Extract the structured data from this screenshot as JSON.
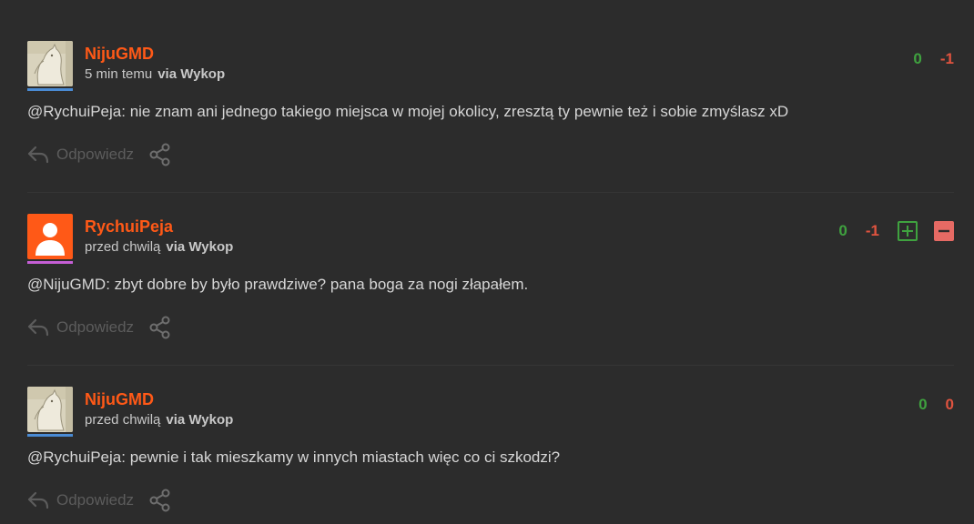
{
  "comments": [
    {
      "username": "NijuGMD",
      "time": "5 min temu",
      "via": "via Wykop",
      "avatar": "horse-avatar",
      "underline_color": "#4a8bd4",
      "votes_plus": "0",
      "votes_minus": "-1",
      "vote_buttons": false,
      "text": "@RychuiPeja: nie znam ani jednego takiego miejsca w mojej okolicy, zresztą ty pewnie też i sobie zmyślasz xD",
      "reply_label": "Odpowiedz"
    },
    {
      "username": "RychuiPeja",
      "time": "przed chwilą",
      "via": "via Wykop",
      "avatar": "default-user-avatar",
      "underline_color": "#c65fd6",
      "votes_plus": "0",
      "votes_minus": "-1",
      "vote_buttons": true,
      "text": "@NijuGMD: zbyt dobre by było prawdziwe? pana boga za nogi złapałem.",
      "reply_label": "Odpowiedz"
    },
    {
      "username": "NijuGMD",
      "time": "przed chwilą",
      "via": "via Wykop",
      "avatar": "horse-avatar",
      "underline_color": "#4a8bd4",
      "votes_plus": "0",
      "votes_minus": "0",
      "vote_buttons": false,
      "text": "@RychuiPeja: pewnie i tak mieszkamy w innych miastach więc co ci szkodzi?",
      "reply_label": "Odpowiedz"
    }
  ],
  "colors": {
    "background": "#2c2c2c",
    "username": "#ff5917",
    "vote_plus": "#3fa23f",
    "vote_minus": "#e0533f",
    "muted_action": "#5c5c5c"
  }
}
